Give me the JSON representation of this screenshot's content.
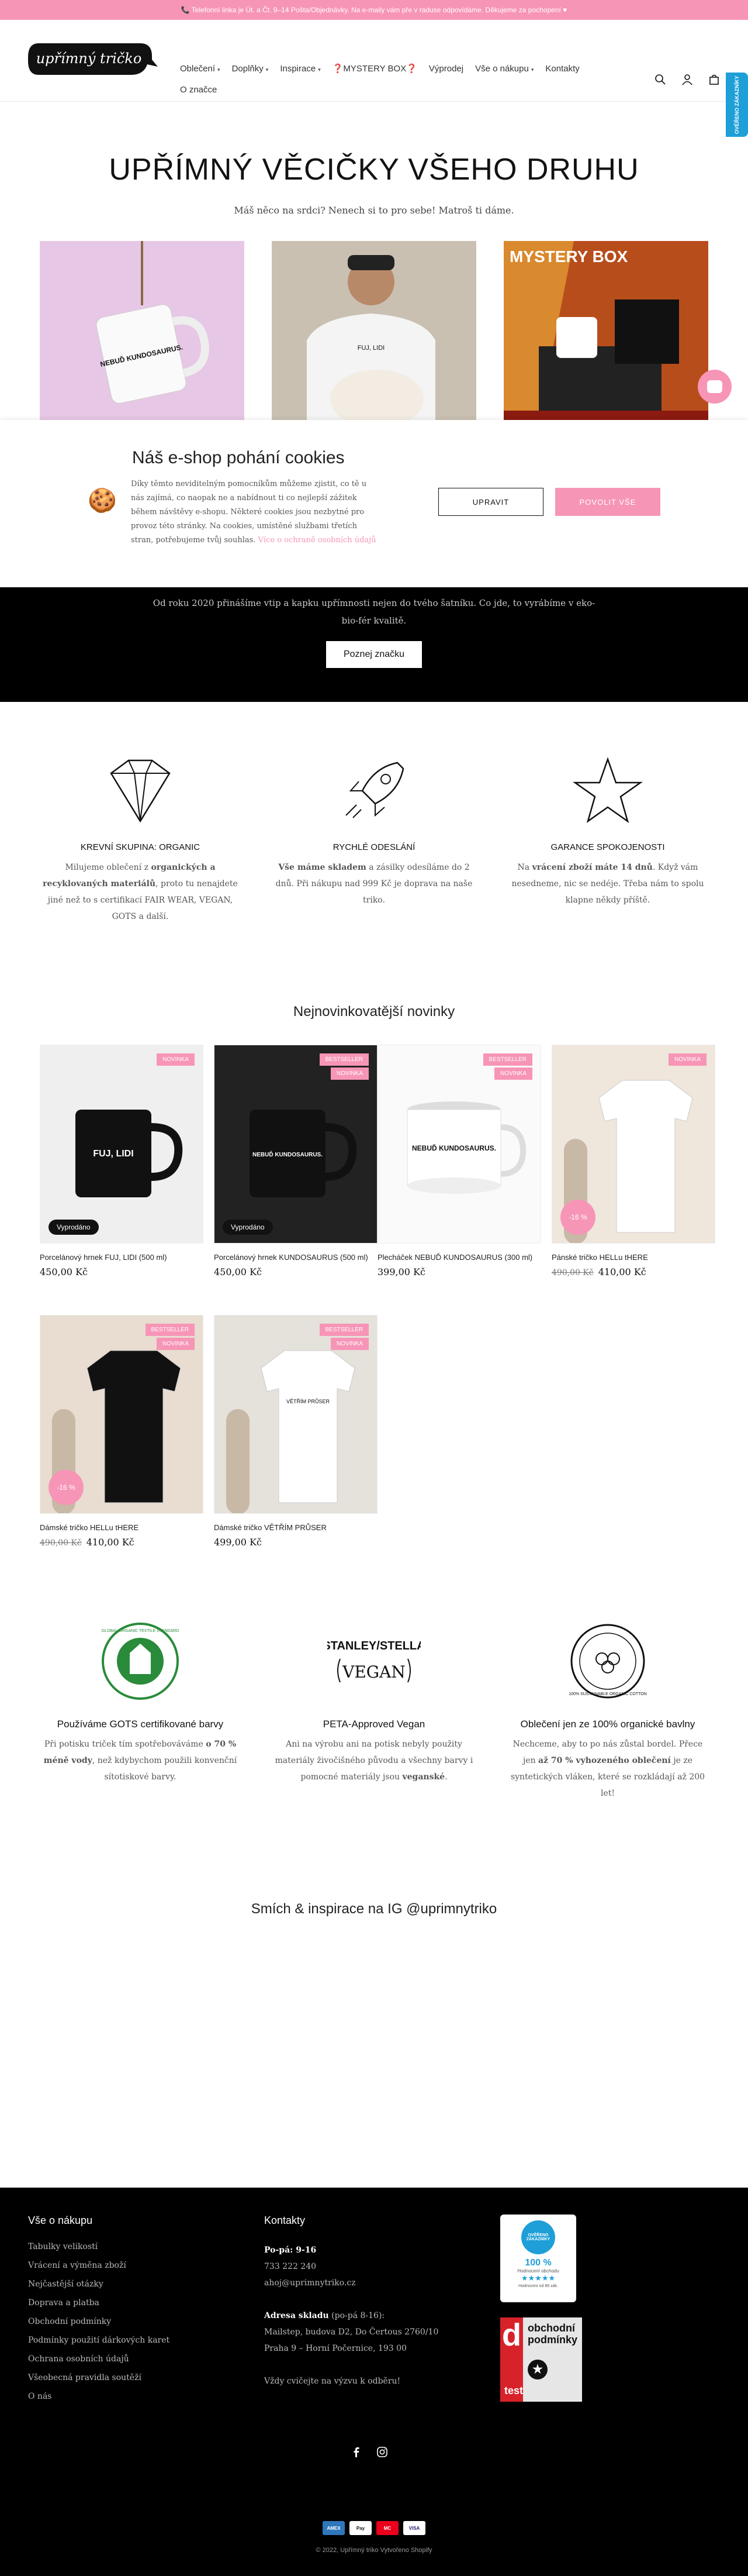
{
  "announcement": "📞 Telefonní linka je Út. a Čt. 9–14 Pošta/Objednávky. Na e-maily vám pře v raduse odpovídáme. Děkujeme za pochopení ♥",
  "logo_text": "upřímný tričko",
  "nav": {
    "row1": [
      {
        "label": "Oblečení",
        "has_dropdown": true
      },
      {
        "label": "Doplňky",
        "has_dropdown": true
      },
      {
        "label": "Inspirace",
        "has_dropdown": true
      },
      {
        "label": "❓MYSTERY BOX❓",
        "has_dropdown": false
      },
      {
        "label": "Výprodej",
        "has_dropdown": false
      },
      {
        "label": "Vše o nákupu",
        "has_dropdown": true
      },
      {
        "label": "Kontakty",
        "has_dropdown": false
      }
    ],
    "row2": [
      {
        "label": "O značce",
        "has_dropdown": false
      }
    ]
  },
  "side_badge": "OVĚŘENO ZÁKAZNÍKY",
  "hero": {
    "title": "UPŘÍMNÝ VĚCIČKY VŠEHO DRUHU",
    "subtitle": "Máš něco na srdci? Nenech si to pro sebe! Matroš ti dáme.",
    "mug_text": "NEBUĎ KUNDOSAURUS.",
    "shirt_text": "FUJ, LIDI",
    "box_text": "MYSTERY BOX"
  },
  "cookies": {
    "title": "Náš e-shop pohání cookies",
    "text": "Díky těmto neviditelným pomocníkům můžeme zjistit, co tě u nás zajímá, co naopak ne a nabídnout ti co nejlepší zážitek během návštěvy e-shopu. Některé cookies jsou nezbytné pro provoz této stránky. Na cookies, umístěné službami třetích stran, potřebujeme tvůj souhlas.",
    "more_link": "Více o ochraně osobních údajů",
    "decline_label": "UPRAVIT",
    "accept_label": "POVOLIT VŠE"
  },
  "brand_band": {
    "text": "Od roku 2020 přinášíme vtip a kapku upřímnosti nejen do tvého šatníku. Co jde, to vyrábíme v eko-bio-fér kvalitě.",
    "button": "Poznej značku"
  },
  "features": [
    {
      "icon": "diamond-icon",
      "title": "KREVNÍ SKUPINA: ORGANIC",
      "text_pre": "Milujeme oblečení z ",
      "bold": "organických a recyklovaných materiálů",
      "text_post": ", proto tu nenajdete jiné než to s certifikací FAIR WEAR, VEGAN, GOTS a další."
    },
    {
      "icon": "rocket-icon",
      "title": "RYCHLÉ ODESLÁNÍ",
      "text_pre": "",
      "bold": "Vše máme skladem",
      "text_post": " a zásilky odesíláme do 2 dnů. Při nákupu nad 999 Kč je doprava na naše triko."
    },
    {
      "icon": "star-icon",
      "title": "GARANCE SPOKOJENOSTI",
      "text_pre": "Na ",
      "bold": "vrácení zboží máte 14 dnů",
      "text_post": ". Když vám nesedneme, nic se nedéje. Třeba nám to spolu klapne někdy příště."
    }
  ],
  "newest": {
    "title": "Nejnovinkovatější novinky",
    "products": [
      {
        "name": "Porcelánový hrnek FUJ, LIDI (500 ml)",
        "price": "450,00 Kč",
        "old_price": "",
        "tags": [
          "NOVINKA"
        ],
        "sold_out": "Vyprodáno",
        "discount": "",
        "print": "FUJ, LIDI"
      },
      {
        "name": "Porcelánový hrnek KUNDOSAURUS (500 ml)",
        "price": "450,00 Kč",
        "old_price": "",
        "tags": [
          "BESTSELLER",
          "NOVINKA"
        ],
        "sold_out": "Vyprodáno",
        "discount": "",
        "print": "NEBUĎ KUNDOSAURUS."
      },
      {
        "name": "Plecháček NEBUĎ KUNDOSAURUS (300 ml)",
        "price": "399,00 Kč",
        "old_price": "",
        "tags": [
          "BESTSELLER",
          "NOVINKA"
        ],
        "sold_out": "",
        "discount": "",
        "print": "NEBUĎ KUNDOSAURUS."
      },
      {
        "name": "Pánské tričko HELLu tHERE",
        "price": "410,00 Kč",
        "old_price": "490,00 Kč",
        "tags": [
          "NOVINKA"
        ],
        "sold_out": "",
        "discount": "-16 %",
        "print": ""
      },
      {
        "name": "Dámské tričko HELLu tHERE",
        "price": "410,00 Kč",
        "old_price": "490,00 Kč",
        "tags": [
          "BESTSELLER",
          "NOVINKA"
        ],
        "sold_out": "",
        "discount": "-16 %",
        "print": ""
      },
      {
        "name": "Dámské tričko VĚTŘÍM PRŮSER",
        "price": "499,00 Kč",
        "old_price": "",
        "tags": [
          "BESTSELLER",
          "NOVINKA"
        ],
        "sold_out": "",
        "discount": "",
        "print": "VĚTŘÍM PRŮSER"
      }
    ]
  },
  "certs": [
    {
      "icon": "gots-logo",
      "title": "Používáme GOTS certifikované barvy",
      "text_pre": "Při potisku triček tím spotřebováváme ",
      "bold": "o 70 % méně vody",
      "text_post": ", než kdybychom použili konvenční sítotiskové barvy.",
      "logo_text": "GLOBAL ORGANIC TEXTILE STANDARD"
    },
    {
      "icon": "vegan-logo",
      "title": "PETA-Approved Vegan",
      "text_pre": "Ani na výrobu ani na potisk nebyly použity materiály živočišného původu a všechny barvy i pomocné materiály jsou ",
      "bold": "veganské",
      "text_post": ".",
      "logo_text": "STANLEY/STELLA",
      "logo_sub": "VEGAN"
    },
    {
      "icon": "organic-cotton-logo",
      "title": "Oblečení jen ze 100% organické bavlny",
      "text_pre": "Nechceme, aby to po nás zůstal bordel. Přece jen ",
      "bold": "až 70 % vyhozeného oblečení",
      "text_post": " je ze syntetických vláken, které se rozkládají až 200 let!",
      "logo_text": "100% SUSTAINABLE ORGANIC COTTON"
    }
  ],
  "instagram_title": "Smích & inspirace na IG @uprimnytriko",
  "footer": {
    "col1_title": "Vše o nákupu",
    "col1_links": [
      "Tabulky velikostí",
      "Vrácení a výměna zboží",
      "Nejčastější otázky",
      "Doprava a platba",
      "Obchodní podmínky",
      "Podmínky použití dárkových karet",
      "Ochrana osobních údajů",
      "Všeobecná pravidla soutěží",
      "O nás"
    ],
    "col2_title": "Kontakty",
    "hours_label": "Po-pá: 9-16",
    "phone": "733 222 240",
    "email": "ahoj@uprimnytriko.cz",
    "warehouse_label": "Adresa skladu",
    "warehouse_hours": "(po-pá 8-16):",
    "warehouse_addr1": "Mailstep, budova D2, Do Čertous 2760/10",
    "warehouse_addr2": "Praha 9 – Horní Počernice, 193 00",
    "note": "Vždy cvičejte na výzvu k odběru!",
    "badge_label": "OVĚŘENO ZÁKAZNÍKY",
    "badge_pct": "100 %",
    "badge_sub": "Hodnocení obchodu",
    "badge_stars": "★★★★★",
    "badge_foot": "Hodnoceni od 89 zák.",
    "dtest_letter": "d",
    "dtest_word": "test",
    "dtest_text": "obchodní podmínky",
    "dtest_star": "★",
    "payments": [
      "AMEX",
      "Pay",
      "MC",
      "VISA"
    ],
    "copyright": "© 2022, Upřímný triko Vytvořeno Shopify"
  },
  "colors": {
    "accent": "#f795b7",
    "dark": "#000000",
    "text": "#121212"
  }
}
